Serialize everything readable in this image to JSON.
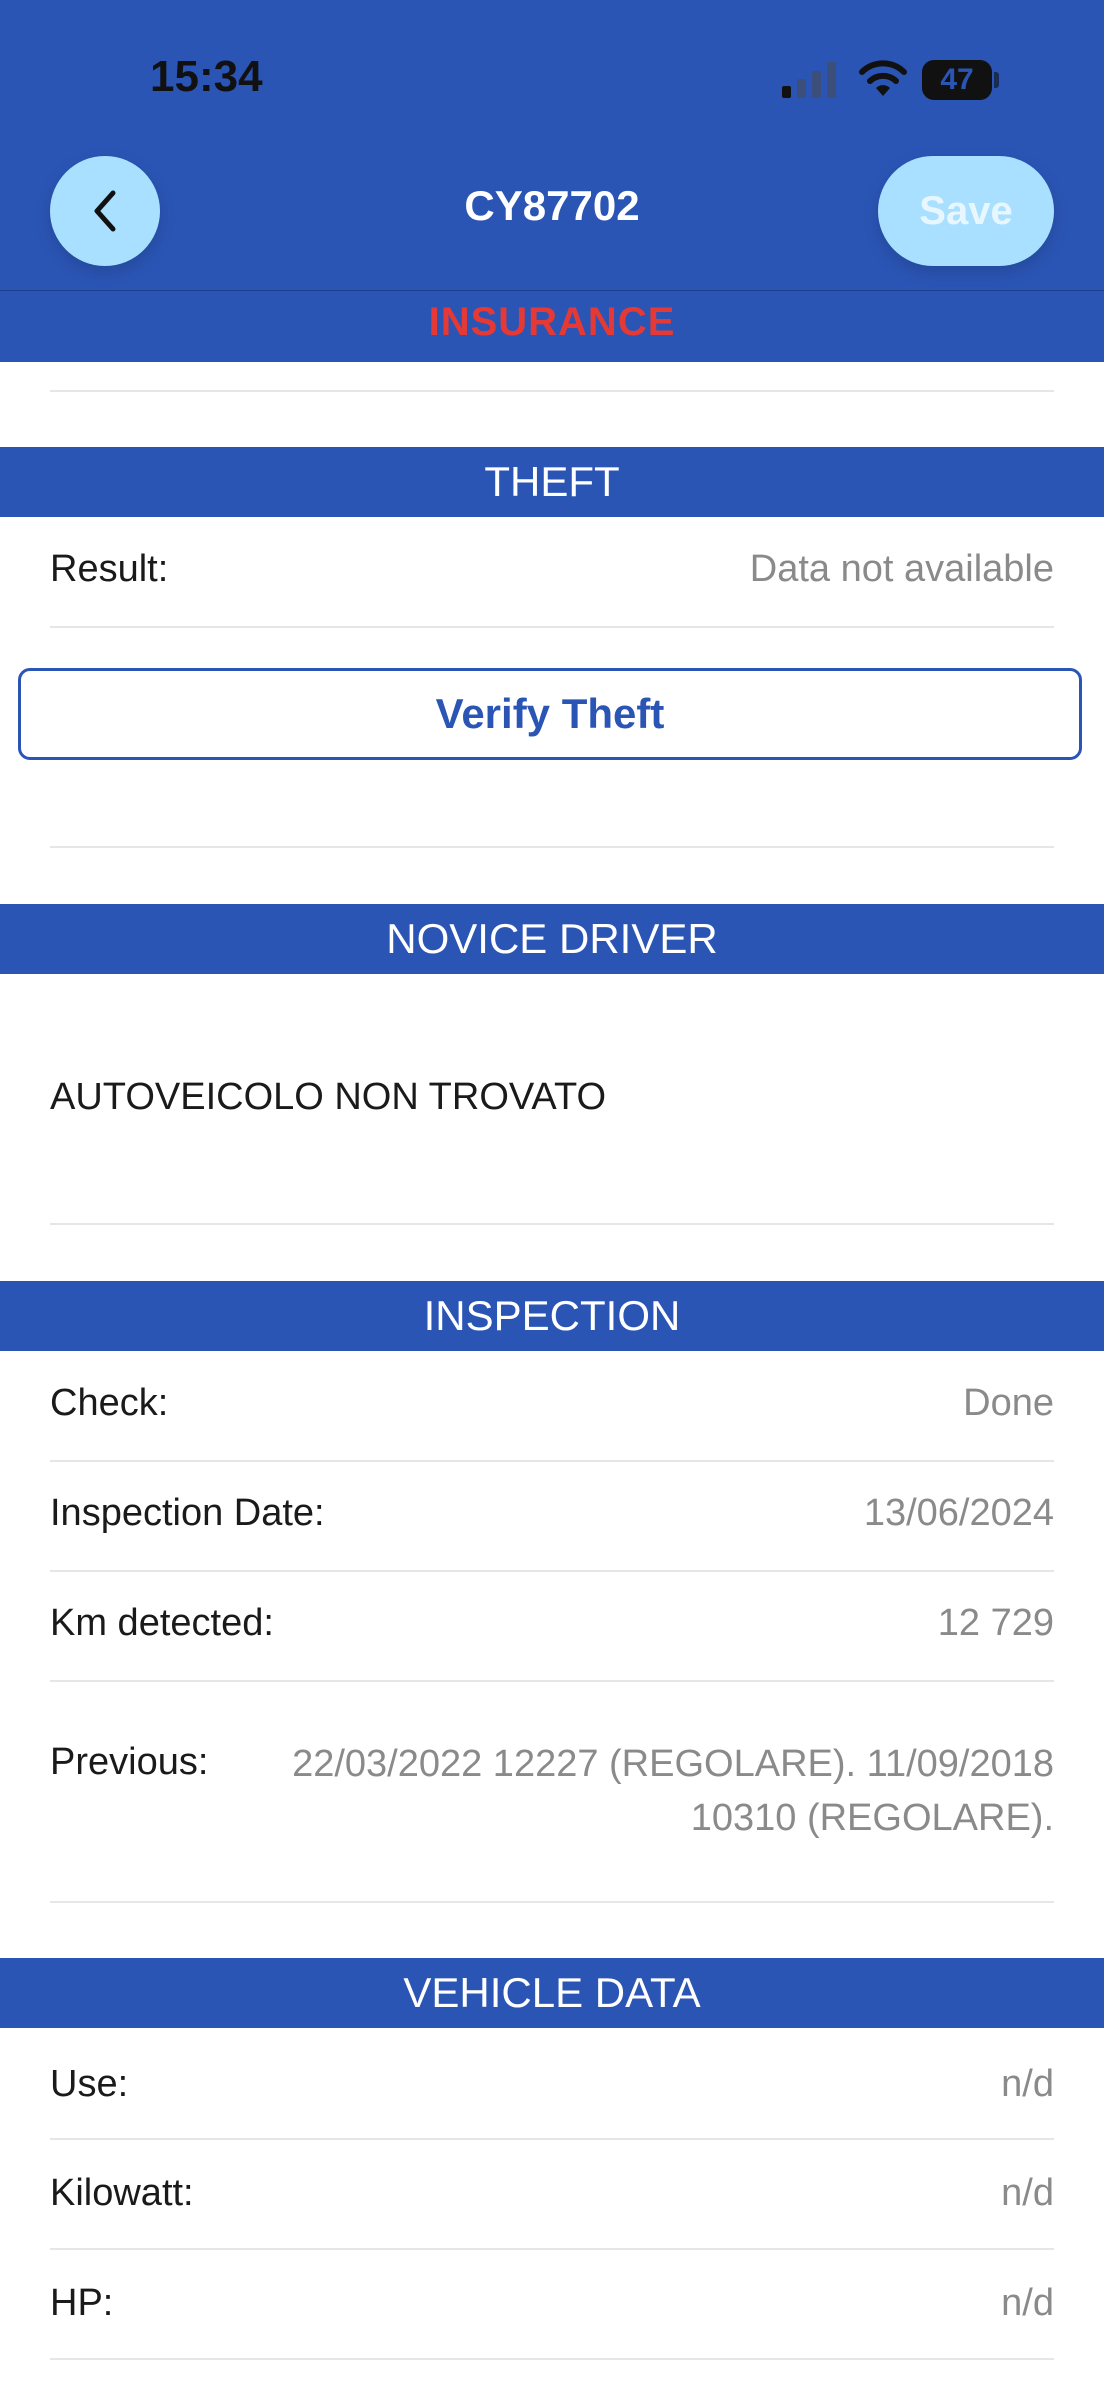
{
  "status_bar": {
    "time": "15:34",
    "battery": "47"
  },
  "header": {
    "title": "CY87702",
    "save_label": "Save",
    "subtitle": "INSURANCE"
  },
  "theft": {
    "section_title": "THEFT",
    "result_label": "Result:",
    "result_value": "Data not available",
    "verify_label": "Verify Theft"
  },
  "novice_driver": {
    "section_title": "NOVICE DRIVER",
    "message": "AUTOVEICOLO NON TROVATO"
  },
  "inspection": {
    "section_title": "INSPECTION",
    "rows": [
      {
        "label": "Check:",
        "value": "Done"
      },
      {
        "label": "Inspection Date:",
        "value": "13/06/2024"
      },
      {
        "label": "Km detected:",
        "value": "12 729"
      }
    ],
    "previous_label": "Previous:",
    "previous_line1": "22/03/2022 12227 (REGOLARE). 11/09/2018",
    "previous_line2": "10310 (REGOLARE)."
  },
  "vehicle_data": {
    "section_title": "VEHICLE DATA",
    "rows": [
      {
        "label": "Use:",
        "value": "n/d"
      },
      {
        "label": "Kilowatt:",
        "value": "n/d"
      },
      {
        "label": "HP:",
        "value": "n/d"
      }
    ]
  },
  "colors": {
    "brand_blue": "#2b55b5",
    "button_light": "#a9e0ff",
    "alert_red": "#e53935"
  }
}
